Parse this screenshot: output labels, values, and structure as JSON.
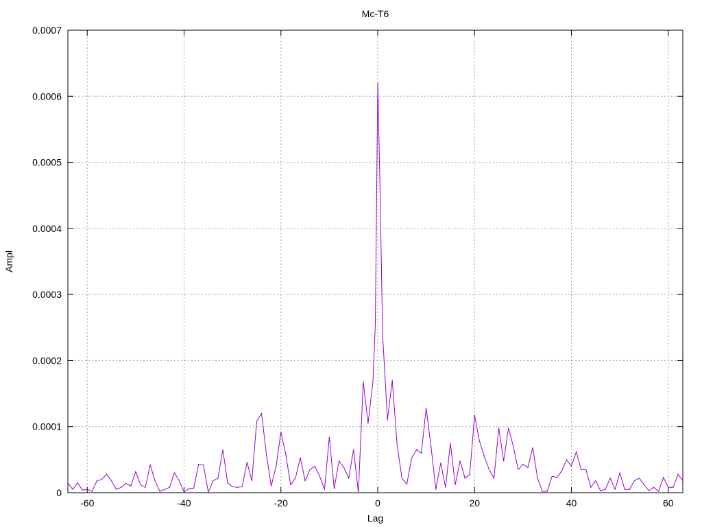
{
  "chart_data": {
    "type": "line",
    "title": "Mc-T6",
    "xlabel": "Lag",
    "ylabel": "Ampl",
    "xlim": [
      -64,
      63
    ],
    "ylim": [
      0,
      0.0007
    ],
    "grid": true,
    "legend": "none",
    "x_ticks": [
      -60,
      -40,
      -20,
      0,
      20,
      40,
      60
    ],
    "x_tick_labels": [
      "-60",
      "-40",
      "-20",
      "0",
      "20",
      "40",
      "60"
    ],
    "y_ticks": [
      0,
      0.0001,
      0.0002,
      0.0003,
      0.0004,
      0.0005,
      0.0006,
      0.0007
    ],
    "y_tick_labels": [
      "0",
      "0.0001",
      "0.0002",
      "0.0003",
      "0.0004",
      "0.0005",
      "0.0006",
      "0.0007"
    ],
    "colors": {
      "series": "#9400d3",
      "grid": "#a0a0a0",
      "axis": "#000000"
    },
    "series": [
      {
        "x": [
          -64,
          -63,
          -62,
          -61,
          -60,
          -59,
          -58,
          -57,
          -56,
          -55,
          -54,
          -53,
          -52,
          -51,
          -50,
          -49,
          -48,
          -47,
          -46,
          -45,
          -44,
          -43,
          -42,
          -41,
          -40,
          -39,
          -38,
          -37,
          -36,
          -35,
          -34,
          -33,
          -32,
          -31,
          -30,
          -29,
          -28,
          -27,
          -26,
          -25,
          -24,
          -23,
          -22,
          -21,
          -20,
          -19,
          -18,
          -17,
          -16,
          -15,
          -14,
          -13,
          -12,
          -11,
          -10,
          -9,
          -8,
          -7,
          -6,
          -5,
          -4,
          -3,
          -2,
          -1,
          -0.5,
          0,
          0.5,
          1,
          2,
          3,
          4,
          5,
          6,
          7,
          8,
          9,
          10,
          11,
          12,
          13,
          14,
          15,
          16,
          17,
          18,
          19,
          20,
          21,
          22,
          23,
          24,
          25,
          26,
          27,
          28,
          29,
          30,
          31,
          32,
          33,
          34,
          35,
          36,
          37,
          38,
          39,
          40,
          41,
          42,
          43,
          44,
          45,
          46,
          47,
          48,
          49,
          50,
          51,
          52,
          53,
          54,
          55,
          56,
          57,
          58,
          59,
          60,
          61,
          62,
          63
        ],
        "values": [
          1.5e-05,
          5e-06,
          1.5e-05,
          4e-06,
          5e-06,
          2e-06,
          1.8e-05,
          2e-05,
          2.8e-05,
          1.8e-05,
          5e-06,
          8e-06,
          1.4e-05,
          1e-05,
          3.2e-05,
          1.2e-05,
          8e-06,
          4.2e-05,
          1.8e-05,
          2e-06,
          5e-06,
          8e-06,
          3e-05,
          1.8e-05,
          1e-06,
          6e-06,
          7e-06,
          4.3e-05,
          4.2e-05,
          1e-06,
          1.8e-05,
          2.2e-05,
          6.5e-05,
          1.5e-05,
          9e-06,
          8e-06,
          9e-06,
          4.6e-05,
          1.8e-05,
          0.000108,
          0.00012,
          5.8e-05,
          1e-05,
          4e-05,
          9.2e-05,
          5.8e-05,
          1.2e-05,
          2.2e-05,
          5.3e-05,
          1.8e-05,
          3.5e-05,
          4e-05,
          2.5e-05,
          5e-06,
          8.4e-05,
          6e-06,
          4.8e-05,
          3.8e-05,
          2.2e-05,
          6.5e-05,
          0.0,
          0.000168,
          0.000105,
          0.000168,
          0.000255,
          0.00062,
          0.00045,
          0.00024,
          0.00011,
          0.00017,
          7.2e-05,
          2.2e-05,
          1.3e-05,
          5.2e-05,
          6.5e-05,
          6e-05,
          0.000128,
          7e-05,
          5e-06,
          4.5e-05,
          8e-06,
          7.5e-05,
          1.2e-05,
          4.8e-05,
          2.2e-05,
          2.8e-05,
          0.000117,
          7.8e-05,
          5.5e-05,
          3.5e-05,
          2.2e-05,
          9.8e-05,
          4.8e-05,
          9.8e-05,
          7e-05,
          3.5e-05,
          4.3e-05,
          3.8e-05,
          6.8e-05,
          2.2e-05,
          2e-06,
          2e-06,
          2.5e-05,
          2.3e-05,
          3.3e-05,
          5e-05,
          4e-05,
          6.2e-05,
          3.5e-05,
          3.5e-05,
          8e-06,
          1.8e-05,
          3e-06,
          5e-06,
          2.2e-05,
          5e-06,
          3e-05,
          5e-06,
          5e-06,
          1.8e-05,
          2.2e-05,
          1.2e-05,
          3e-06,
          8e-06,
          2e-06,
          2.3e-05,
          8e-06,
          8e-06,
          2.8e-05,
          1.8e-05
        ]
      }
    ]
  }
}
